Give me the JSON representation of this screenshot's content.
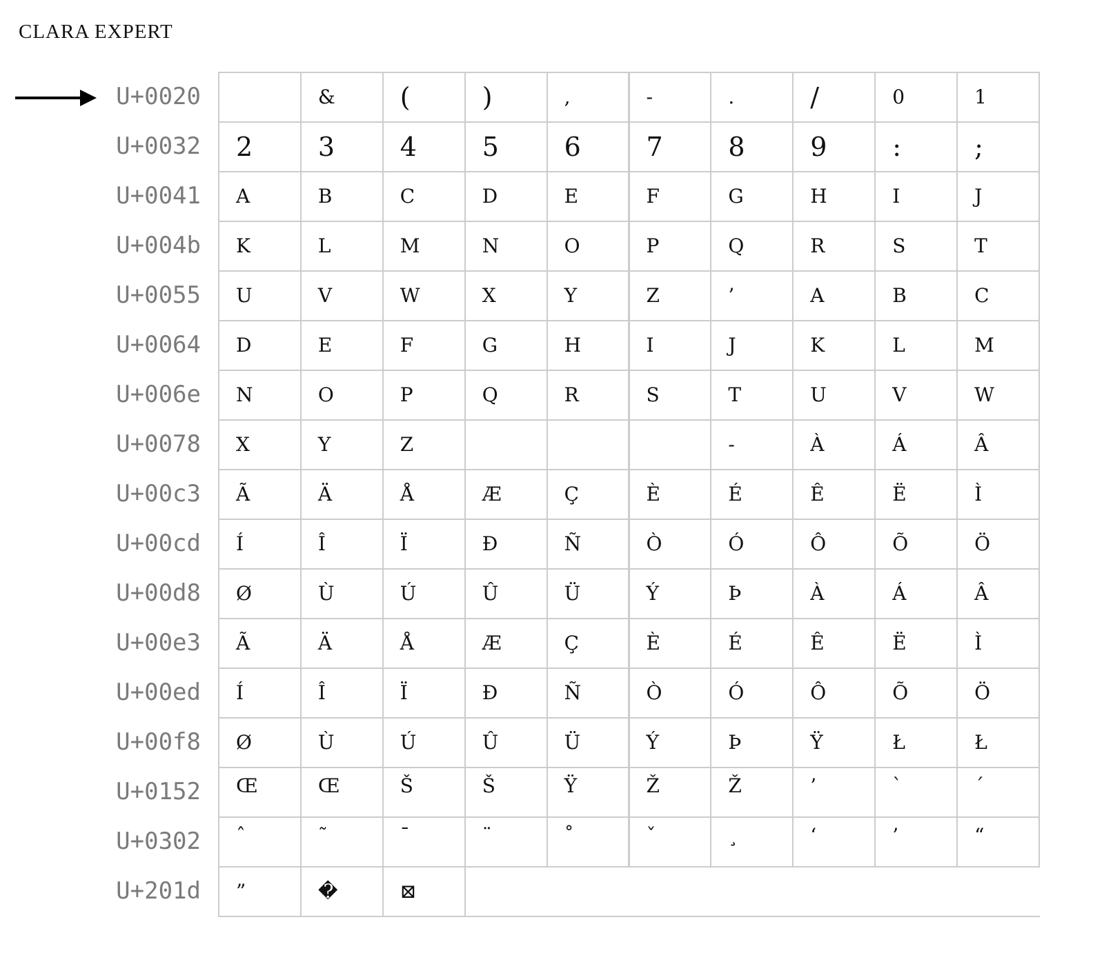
{
  "title": "CLARA EXPERT",
  "rows": [
    {
      "label": "U+0020",
      "cells": [
        " ",
        "&",
        "(",
        ")",
        ",",
        "-",
        ".",
        "/",
        "0",
        "1"
      ]
    },
    {
      "label": "U+0032",
      "cells": [
        "2",
        "3",
        "4",
        "5",
        "6",
        "7",
        "8",
        "9",
        ":",
        ";"
      ]
    },
    {
      "label": "U+0041",
      "cells": [
        "A",
        "B",
        "C",
        "D",
        "E",
        "F",
        "G",
        "H",
        "I",
        "J"
      ]
    },
    {
      "label": "U+004b",
      "cells": [
        "K",
        "L",
        "M",
        "N",
        "O",
        "P",
        "Q",
        "R",
        "S",
        "T"
      ]
    },
    {
      "label": "U+0055",
      "cells": [
        "U",
        "V",
        "W",
        "X",
        "Y",
        "Z",
        "’",
        "A",
        "B",
        "C"
      ]
    },
    {
      "label": "U+0064",
      "cells": [
        "D",
        "E",
        "F",
        "G",
        "H",
        "I",
        "J",
        "K",
        "L",
        "M"
      ]
    },
    {
      "label": "U+006e",
      "cells": [
        "N",
        "O",
        "P",
        "Q",
        "R",
        "S",
        "T",
        "U",
        "V",
        "W"
      ]
    },
    {
      "label": "U+0078",
      "cells": [
        "X",
        "Y",
        "Z",
        "",
        "",
        "",
        "-",
        "À",
        "Á",
        "Â"
      ]
    },
    {
      "label": "U+00c3",
      "cells": [
        "Ã",
        "Ä",
        "Å",
        "Æ",
        "Ç",
        "È",
        "É",
        "Ê",
        "Ë",
        "Ì"
      ]
    },
    {
      "label": "U+00cd",
      "cells": [
        "Í",
        "Î",
        "Ï",
        "Đ",
        "Ñ",
        "Ò",
        "Ó",
        "Ô",
        "Õ",
        "Ö"
      ]
    },
    {
      "label": "U+00d8",
      "cells": [
        "Ø",
        "Ù",
        "Ú",
        "Û",
        "Ü",
        "Ý",
        "Þ",
        "À",
        "Á",
        "Â"
      ]
    },
    {
      "label": "U+00e3",
      "cells": [
        "Ã",
        "Ä",
        "Å",
        "Æ",
        "Ç",
        "È",
        "É",
        "Ê",
        "Ë",
        "Ì"
      ]
    },
    {
      "label": "U+00ed",
      "cells": [
        "Í",
        "Î",
        "Ï",
        "Đ",
        "Ñ",
        "Ò",
        "Ó",
        "Ô",
        "Õ",
        "Ö"
      ]
    },
    {
      "label": "U+00f8",
      "cells": [
        "Ø",
        "Ù",
        "Ú",
        "Û",
        "Ü",
        "Ý",
        "Þ",
        "Ÿ",
        "Ł",
        "Ł"
      ]
    },
    {
      "label": "U+0152",
      "cells": [
        "Œ",
        "Œ",
        "Š",
        "Š",
        "Ÿ",
        "Ž",
        "Ž",
        "’",
        "`",
        "´"
      ]
    },
    {
      "label": "U+0302",
      "cells": [
        "ˆ",
        "˜",
        "¯",
        "¨",
        "˚",
        "ˇ",
        "¸",
        "‘",
        "’",
        "“"
      ]
    },
    {
      "label": "U+201d",
      "cells": [
        "”",
        "�",
        "⊠"
      ]
    }
  ]
}
